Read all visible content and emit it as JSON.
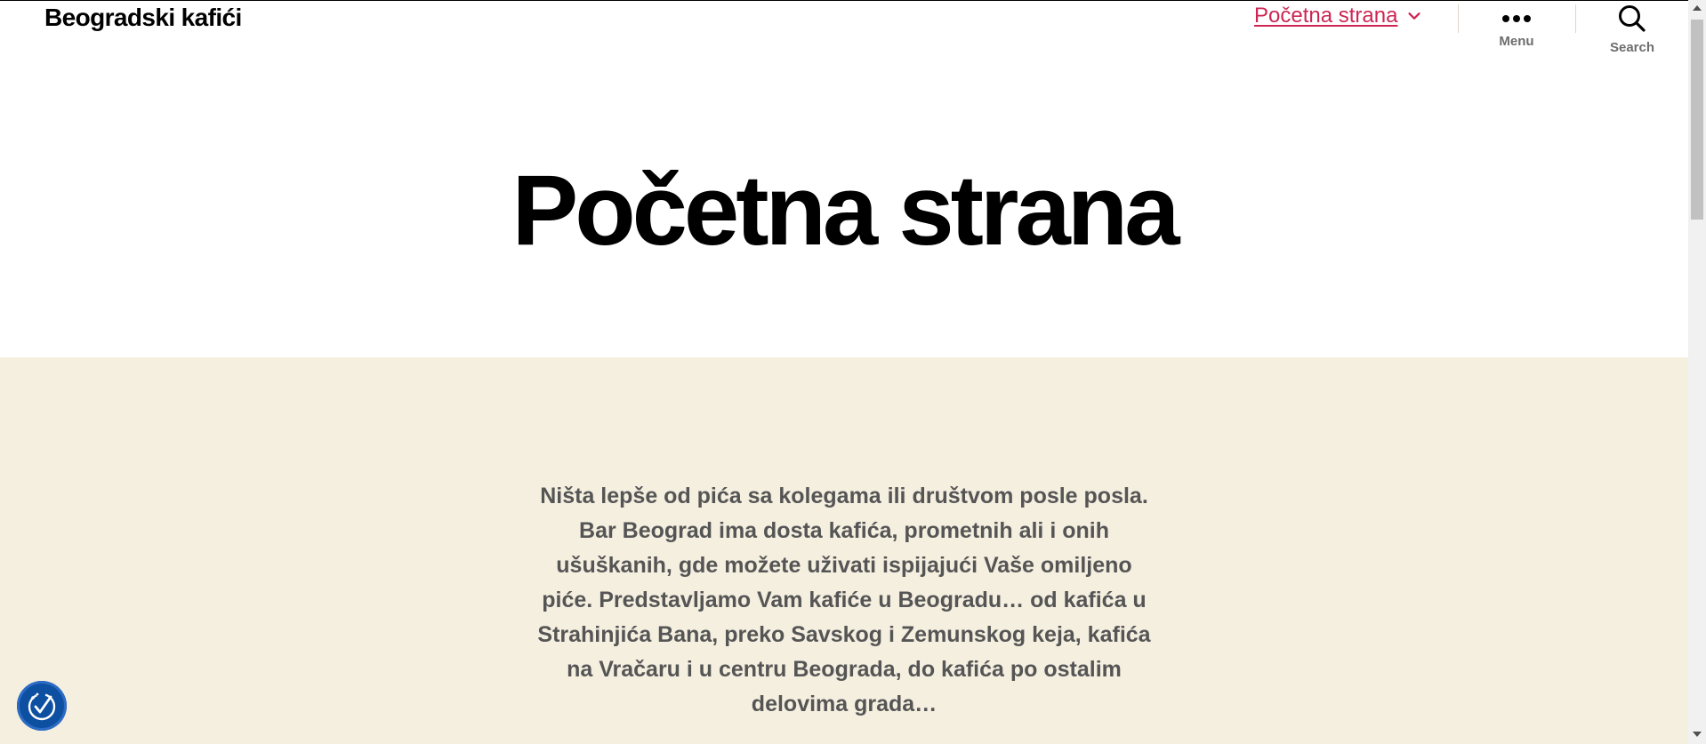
{
  "header": {
    "site_title": "Beogradski kafići",
    "nav_item": "Početna strana",
    "menu_label": "Menu",
    "search_label": "Search"
  },
  "page": {
    "title": "Početna strana",
    "intro": "Ništa lepše od pića sa kolegama ili društvom posle posla. Bar Beograd ima dosta kafića, prometnih ali i onih ušuškanih, gde možete uživati ispijajući Vaše omiljeno piće. Predstavljamo Vam kafiće u Beogradu… od kafića u Strahinjića Bana, preko Savskog i Zemunskog keja, kafića na Vračaru i u centru Beograda, do kafića po ostalim delovima grada…"
  },
  "colors": {
    "accent": "#cd2653",
    "content_bg": "#f5efe0",
    "a11y_button": "#0d4fa1"
  },
  "icons": [
    "chevron-down-icon",
    "menu-dots-icon",
    "search-icon",
    "accessibility-icon"
  ]
}
